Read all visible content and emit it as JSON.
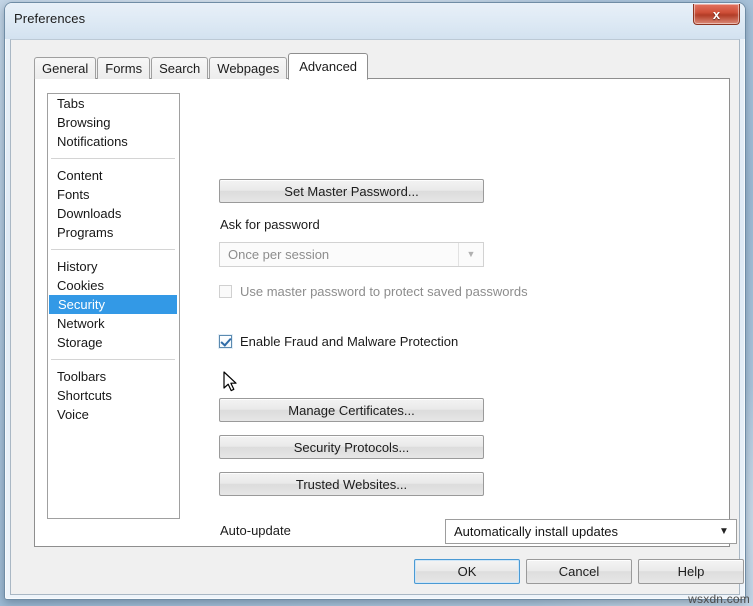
{
  "window": {
    "title": "Preferences",
    "close_label": "x",
    "close_icon": "close-icon"
  },
  "tabs": [
    {
      "label": "General",
      "active": false
    },
    {
      "label": "Forms",
      "active": false
    },
    {
      "label": "Search",
      "active": false
    },
    {
      "label": "Webpages",
      "active": false
    },
    {
      "label": "Advanced",
      "active": true
    }
  ],
  "sidebar": {
    "groups": [
      {
        "items": [
          {
            "label": "Tabs",
            "selected": false
          },
          {
            "label": "Browsing",
            "selected": false
          },
          {
            "label": "Notifications",
            "selected": false
          }
        ]
      },
      {
        "items": [
          {
            "label": "Content",
            "selected": false
          },
          {
            "label": "Fonts",
            "selected": false
          },
          {
            "label": "Downloads",
            "selected": false
          },
          {
            "label": "Programs",
            "selected": false
          }
        ]
      },
      {
        "items": [
          {
            "label": "History",
            "selected": false
          },
          {
            "label": "Cookies",
            "selected": false
          },
          {
            "label": "Security",
            "selected": true
          },
          {
            "label": "Network",
            "selected": false
          },
          {
            "label": "Storage",
            "selected": false
          }
        ]
      },
      {
        "items": [
          {
            "label": "Toolbars",
            "selected": false
          },
          {
            "label": "Shortcuts",
            "selected": false
          },
          {
            "label": "Voice",
            "selected": false
          }
        ]
      }
    ]
  },
  "pane": {
    "set_master_password_button": "Set Master Password...",
    "ask_for_password_label": "Ask for password",
    "ask_for_password_value": "Once per session",
    "use_master_password_label": "Use master password to protect saved passwords",
    "use_master_password_checked": false,
    "enable_fraud_label": "Enable Fraud and Malware Protection",
    "enable_fraud_checked": true,
    "manage_certificates_button": "Manage Certificates...",
    "security_protocols_button": "Security Protocols...",
    "trusted_websites_button": "Trusted Websites...",
    "auto_update_label": "Auto-update",
    "auto_update_value": "Automatically install updates",
    "dropdown_arrow": "▼"
  },
  "footer": {
    "ok_label": "OK",
    "cancel_label": "Cancel",
    "help_label": "Help"
  },
  "watermark": "wsxdn.com",
  "colors": {
    "selection_blue": "#3399e6",
    "close_red": "#cf4f38",
    "default_button_focus": "#4a9ad4",
    "disabled_text": "#8d8d8d"
  }
}
